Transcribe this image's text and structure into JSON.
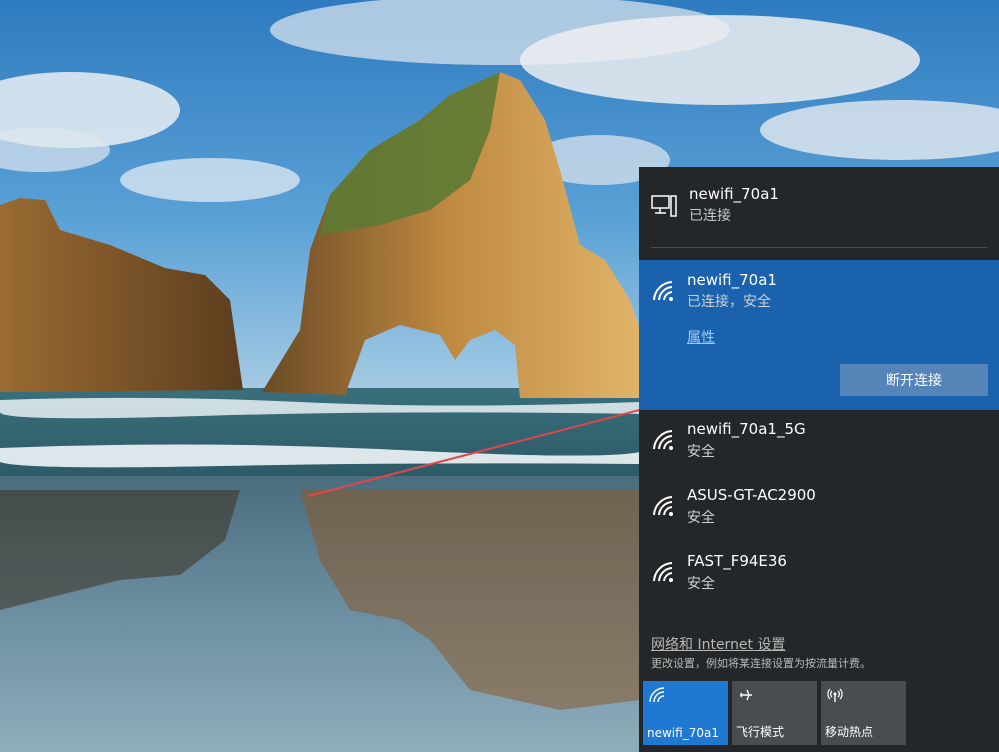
{
  "current_connection": {
    "name": "newifi_70a1",
    "status": "已连接",
    "icon": "ethernet-pc-icon"
  },
  "networks": [
    {
      "ssid": "newifi_70a1",
      "status": "已连接，安全",
      "properties_label": "属性",
      "disconnect_label": "断开连接",
      "icon": "wifi-icon"
    },
    {
      "ssid": "newifi_70a1_5G",
      "status": "安全",
      "icon": "wifi-icon"
    },
    {
      "ssid": "ASUS-GT-AC2900",
      "status": "安全",
      "icon": "wifi-icon"
    },
    {
      "ssid": "FAST_F94E36",
      "status": "安全",
      "icon": "wifi-icon"
    }
  ],
  "settings": {
    "link_label": "网络和 Internet 设置",
    "description": "更改设置，例如将某连接设置为按流量计费。"
  },
  "quick_actions": [
    {
      "label": "newifi_70a1",
      "icon": "wifi-icon",
      "active": true
    },
    {
      "label": "飞行模式",
      "icon": "airplane-icon",
      "active": false
    },
    {
      "label": "移动热点",
      "icon": "hotspot-icon",
      "active": false
    }
  ],
  "colors": {
    "flyout_bg": "#242729",
    "selected_bg": "#1a62ae",
    "accent_tile": "#1f78d1",
    "annotation_arrow": "#e0464b"
  }
}
